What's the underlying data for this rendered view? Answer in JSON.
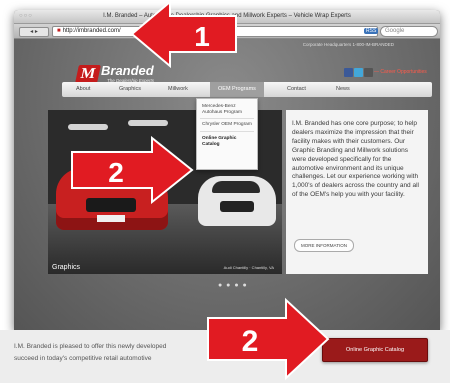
{
  "browser": {
    "window_controls": "○○○",
    "title": "I.M. Branded – Automotive Dealership Graphics and Millwork Experts – Vehicle Wrap Experts",
    "nav_buttons": "◂ ▸",
    "url": "http://imbranded.com/",
    "rss_label": "RSS",
    "search_placeholder": "Google"
  },
  "site": {
    "topline": "Corporate Headquarters  1-800-IM-BRANDED",
    "logo": {
      "mark": "M",
      "word": "Branded",
      "tagline": "The Dealership Experts"
    },
    "career_link": "— Career Opportunities",
    "nav": [
      {
        "label": "About"
      },
      {
        "label": "Graphics"
      },
      {
        "label": "Millwork"
      },
      {
        "label": "OEM Programs"
      },
      {
        "label": "Contact"
      },
      {
        "label": "News"
      }
    ],
    "dropdown": [
      {
        "label": "Mercedes-Benz Autohaus Program"
      },
      {
        "label": "Chrysler OEM Program"
      },
      {
        "label": "Online Graphic Catalog"
      }
    ],
    "slider": {
      "label": "Graphics",
      "caption": "Audi Chantilly · Chantilly, VA"
    },
    "info_text": "I.M. Branded has one core purpose; to help dealers maximize the impression that their facility makes with their customers. Our Graphic Branding and Millwork solutions were developed specifically for the automotive environment and its unique challenges. Let our experience working with 1,000's of dealers across the country and all of the OEM's help you with your facility.",
    "more_button": "MORE INFORMATION",
    "slide_dots": "● ● ● ●"
  },
  "lower": {
    "text_line1": "I.M. Branded is pleased to offer this newly developed",
    "text_line2": "succeed in today's competitive retail automotive",
    "button": "Online Graphic Catalog"
  },
  "callouts": [
    {
      "number": "1"
    },
    {
      "number": "2"
    },
    {
      "number": "2"
    }
  ],
  "colors": {
    "callout_red": "#e11b22",
    "brand_red": "#c51c1c",
    "catalog_button": "#9a1a1a"
  }
}
